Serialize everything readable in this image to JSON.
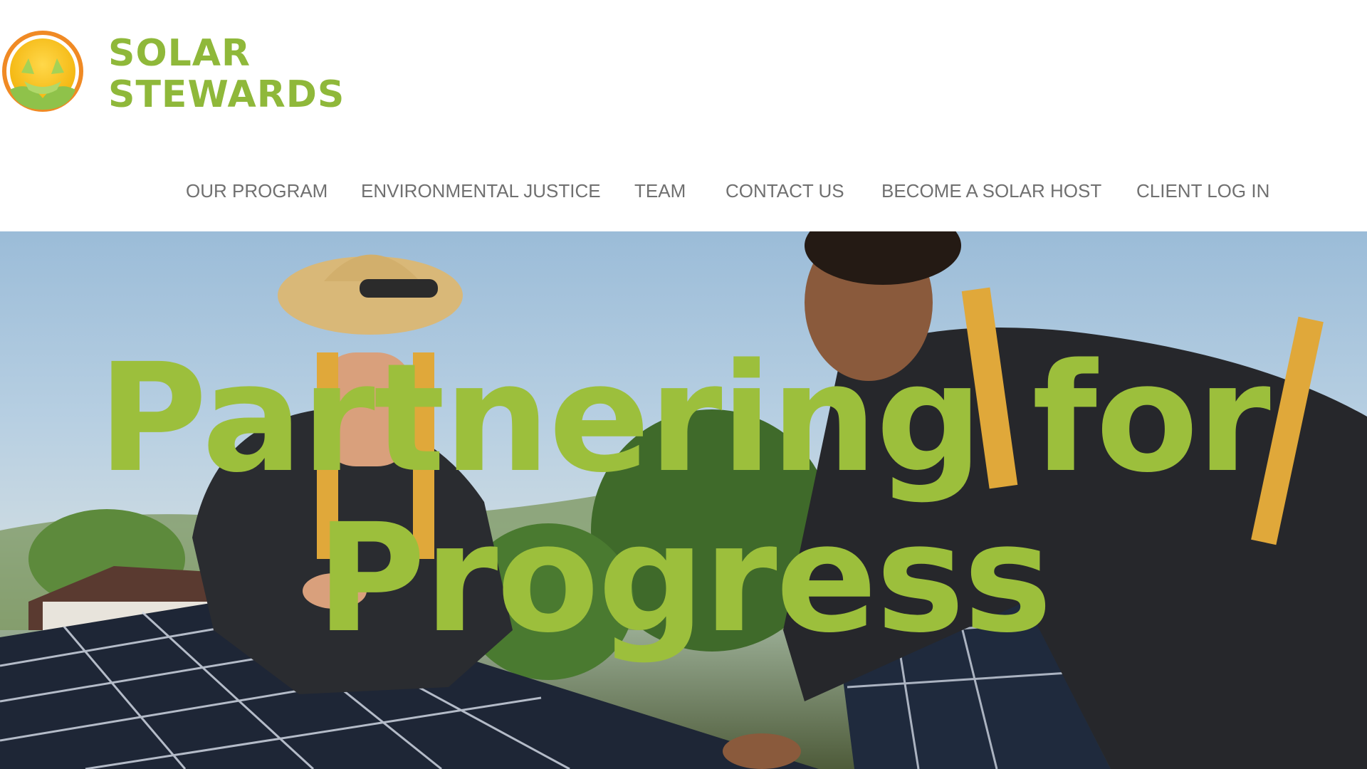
{
  "brand": {
    "line1": "SOLAR",
    "line2": "STEWARDS",
    "color": "#8fb83a"
  },
  "nav": {
    "items": [
      {
        "label": "OUR PROGRAM"
      },
      {
        "label": "ENVIRONMENTAL JUSTICE"
      },
      {
        "label": "TEAM"
      },
      {
        "label": "CONTACT US"
      },
      {
        "label": "BECOME A SOLAR HOST"
      },
      {
        "label": "CLIENT LOG IN"
      }
    ],
    "color": "#707070"
  },
  "hero": {
    "headline_line1": "Partnering for",
    "headline_line2": "Progress",
    "headline_color": "#9cbf3c",
    "image": "two solar installers in harnesses on a rooftop next to solar panels"
  }
}
